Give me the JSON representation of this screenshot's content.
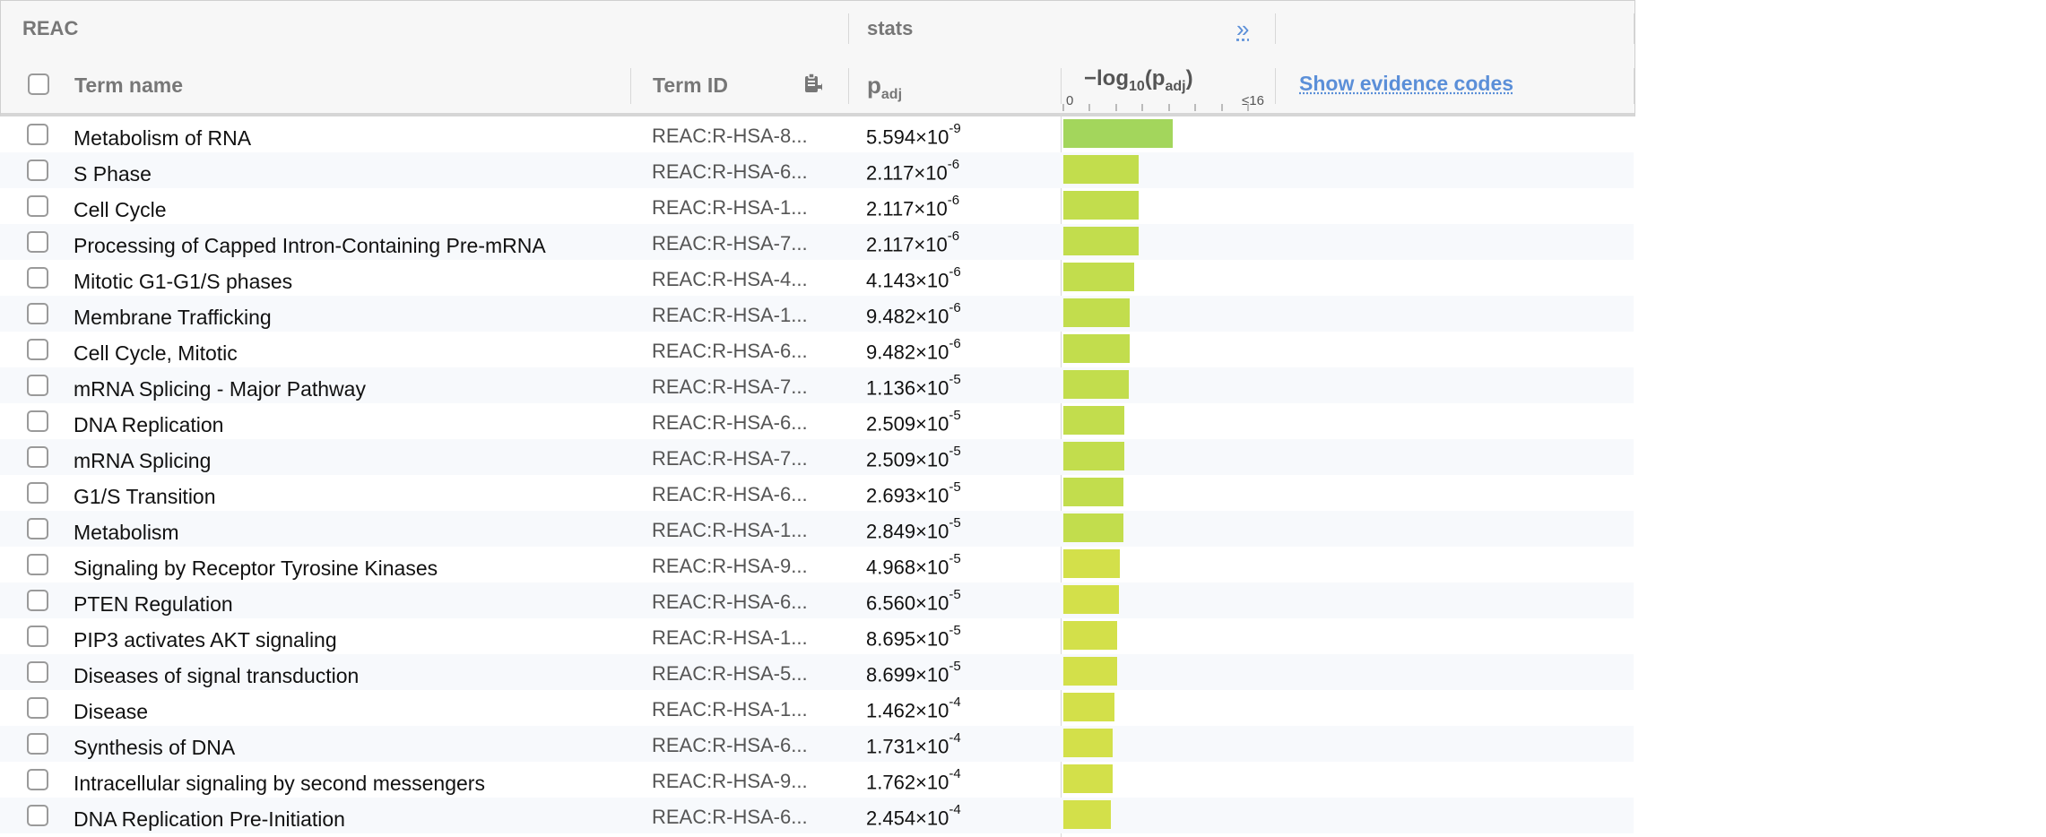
{
  "header": {
    "source": "REAC",
    "stats": "stats",
    "expand_glyph": "»",
    "term_name": "Term name",
    "term_id": "Term ID",
    "padj_main": "p",
    "padj_sub": "adj",
    "log_prefix": "−log",
    "log_sub": "10",
    "log_open": "(p",
    "log_padj_sub": "adj",
    "log_close": ")",
    "axis_min": "0",
    "axis_max": "≤16",
    "evidence_link": "Show evidence codes"
  },
  "colors": {
    "bar_top": "#a3d65c",
    "bar_mid": "#c2dd4d",
    "bar_low": "#d3e04a",
    "link": "#5b8fd8"
  },
  "axis_max_value": 16,
  "rows": [
    {
      "name": "Metabolism of RNA",
      "id": "REAC:R-HSA-8...",
      "mant": "5.594×10",
      "exp": "-9",
      "neglog": 8.25
    },
    {
      "name": "S Phase",
      "id": "REAC:R-HSA-6...",
      "mant": "2.117×10",
      "exp": "-6",
      "neglog": 5.67
    },
    {
      "name": "Cell Cycle",
      "id": "REAC:R-HSA-1...",
      "mant": "2.117×10",
      "exp": "-6",
      "neglog": 5.67
    },
    {
      "name": "Processing of Capped Intron-Containing Pre-mRNA",
      "id": "REAC:R-HSA-7...",
      "mant": "2.117×10",
      "exp": "-6",
      "neglog": 5.67
    },
    {
      "name": "Mitotic G1-G1/S phases",
      "id": "REAC:R-HSA-4...",
      "mant": "4.143×10",
      "exp": "-6",
      "neglog": 5.38
    },
    {
      "name": "Membrane Trafficking",
      "id": "REAC:R-HSA-1...",
      "mant": "9.482×10",
      "exp": "-6",
      "neglog": 5.02
    },
    {
      "name": "Cell Cycle, Mitotic",
      "id": "REAC:R-HSA-6...",
      "mant": "9.482×10",
      "exp": "-6",
      "neglog": 5.02
    },
    {
      "name": "mRNA Splicing - Major Pathway",
      "id": "REAC:R-HSA-7...",
      "mant": "1.136×10",
      "exp": "-5",
      "neglog": 4.94
    },
    {
      "name": "DNA Replication",
      "id": "REAC:R-HSA-6...",
      "mant": "2.509×10",
      "exp": "-5",
      "neglog": 4.6
    },
    {
      "name": "mRNA Splicing",
      "id": "REAC:R-HSA-7...",
      "mant": "2.509×10",
      "exp": "-5",
      "neglog": 4.6
    },
    {
      "name": "G1/S Transition",
      "id": "REAC:R-HSA-6...",
      "mant": "2.693×10",
      "exp": "-5",
      "neglog": 4.57
    },
    {
      "name": "Metabolism",
      "id": "REAC:R-HSA-1...",
      "mant": "2.849×10",
      "exp": "-5",
      "neglog": 4.55
    },
    {
      "name": "Signaling by Receptor Tyrosine Kinases",
      "id": "REAC:R-HSA-9...",
      "mant": "4.968×10",
      "exp": "-5",
      "neglog": 4.3
    },
    {
      "name": "PTEN Regulation",
      "id": "REAC:R-HSA-6...",
      "mant": "6.560×10",
      "exp": "-5",
      "neglog": 4.18
    },
    {
      "name": "PIP3 activates AKT signaling",
      "id": "REAC:R-HSA-1...",
      "mant": "8.695×10",
      "exp": "-5",
      "neglog": 4.06
    },
    {
      "name": "Diseases of signal transduction",
      "id": "REAC:R-HSA-5...",
      "mant": "8.699×10",
      "exp": "-5",
      "neglog": 4.06
    },
    {
      "name": "Disease",
      "id": "REAC:R-HSA-1...",
      "mant": "1.462×10",
      "exp": "-4",
      "neglog": 3.84
    },
    {
      "name": "Synthesis of DNA",
      "id": "REAC:R-HSA-6...",
      "mant": "1.731×10",
      "exp": "-4",
      "neglog": 3.76
    },
    {
      "name": "Intracellular signaling by second messengers",
      "id": "REAC:R-HSA-9...",
      "mant": "1.762×10",
      "exp": "-4",
      "neglog": 3.75
    },
    {
      "name": "DNA Replication Pre-Initiation",
      "id": "REAC:R-HSA-6...",
      "mant": "2.454×10",
      "exp": "-4",
      "neglog": 3.61
    }
  ]
}
